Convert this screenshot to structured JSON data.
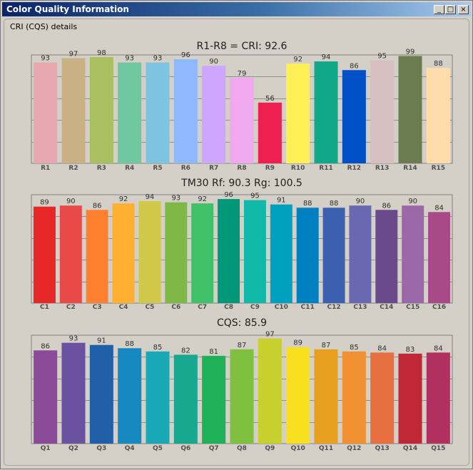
{
  "window": {
    "title": "Color Quality Information",
    "minimize_label": "_",
    "maximize_label": "□",
    "close_label": "×"
  },
  "panel": {
    "title": "CRI (CQS) details"
  },
  "chart_data": [
    {
      "type": "bar",
      "title": "R1-R8 = CRI: 92.6",
      "categories": [
        "R1",
        "R2",
        "R3",
        "R4",
        "R5",
        "R6",
        "R7",
        "R8",
        "R9",
        "R10",
        "R11",
        "R12",
        "R13",
        "R14",
        "R15"
      ],
      "values": [
        93,
        97,
        98,
        93,
        93,
        96,
        90,
        79,
        56,
        92,
        94,
        86,
        95,
        99,
        88
      ],
      "ylim": [
        0,
        100
      ],
      "grid": true,
      "colors": [
        "#e8a8b0",
        "#c9b085",
        "#a8c060",
        "#6fc8a0",
        "#7cc4e0",
        "#90b8ff",
        "#cfa6ff",
        "#f0a8ee",
        "#ee2050",
        "#fff058",
        "#10a888",
        "#0050c8",
        "#d8c0c0",
        "#6b7d50",
        "#ffdcaa"
      ]
    },
    {
      "type": "bar",
      "title": "TM30   Rf: 90.3    Rg: 100.5",
      "categories": [
        "C1",
        "C2",
        "C3",
        "C4",
        "C5",
        "C6",
        "C7",
        "C8",
        "C9",
        "C10",
        "C11",
        "C12",
        "C13",
        "C14",
        "C15",
        "C16"
      ],
      "values": [
        89,
        90,
        86,
        92,
        94,
        93,
        92,
        96,
        95,
        91,
        88,
        88,
        90,
        86,
        90,
        84
      ],
      "ylim": [
        0,
        100
      ],
      "grid": true,
      "colors": [
        "#e82828",
        "#e84a4a",
        "#ff8030",
        "#ffb030",
        "#d0c848",
        "#80b848",
        "#40c068",
        "#009878",
        "#10b8a8",
        "#00a0c0",
        "#0080c0",
        "#3c60b0",
        "#6a68b0",
        "#6a4a8a",
        "#9a68a8",
        "#a84a88"
      ]
    },
    {
      "type": "bar",
      "title": "CQS: 85.9",
      "categories": [
        "Q1",
        "Q2",
        "Q3",
        "Q4",
        "Q5",
        "Q6",
        "Q7",
        "Q8",
        "Q9",
        "Q10",
        "Q11",
        "Q12",
        "Q13",
        "Q14",
        "Q15"
      ],
      "values": [
        86,
        93,
        91,
        88,
        85,
        82,
        81,
        87,
        97,
        89,
        87,
        85,
        84,
        83,
        84
      ],
      "ylim": [
        0,
        100
      ],
      "grid": true,
      "colors": [
        "#8a4a98",
        "#6a52a0",
        "#2060a8",
        "#1888c0",
        "#18a8b8",
        "#18a890",
        "#20b058",
        "#80c040",
        "#c8d030",
        "#f8e020",
        "#e8a020",
        "#f09030",
        "#e87040",
        "#c02838",
        "#b03060"
      ]
    }
  ]
}
